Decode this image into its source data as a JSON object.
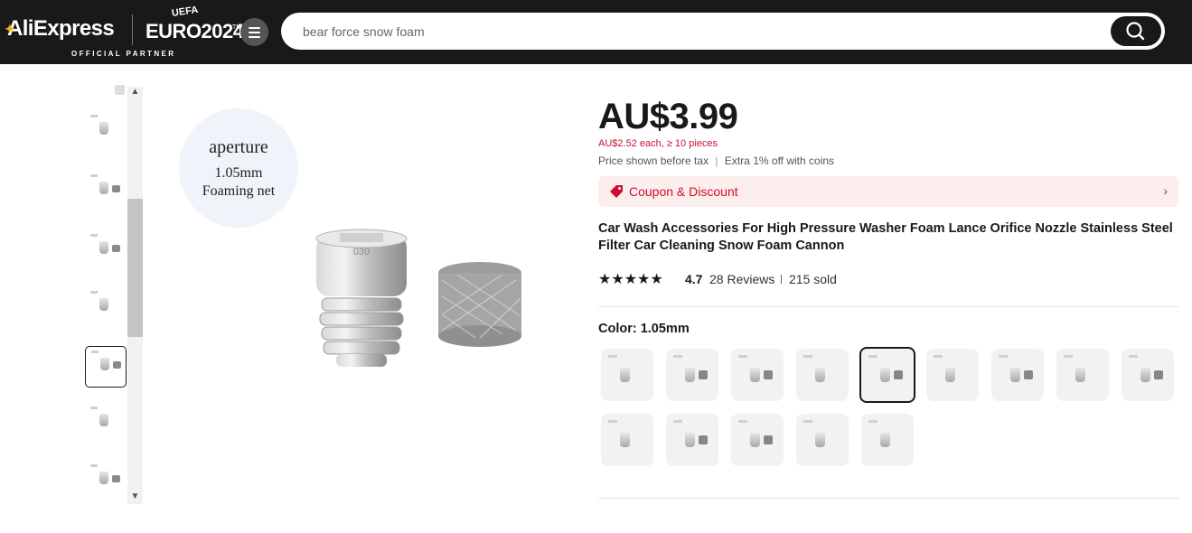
{
  "header": {
    "logo_text": "AliExpress",
    "euro_text": "EURO2024",
    "uefa_text": "UEFA",
    "tm": "TM",
    "partner_text": "OFFICIAL PARTNER",
    "search_value": "bear force snow foam"
  },
  "gallery": {
    "bubble_line1": "aperture",
    "bubble_line2": "1.05mm",
    "bubble_line3": "Foaming net",
    "nozzle_engraving": "030"
  },
  "product": {
    "price": "AU$3.99",
    "bulk_price": "AU$2.52 each, ≥ 10 pieces",
    "tax_note": "Price shown before tax",
    "coins_note": "Extra 1% off with coins",
    "coupon_label": "Coupon & Discount",
    "title": "Car Wash Accessories For High Pressure Washer Foam Lance Orifice Nozzle Stainless Steel Filter Car Cleaning Snow Foam Cannon",
    "rating": "4.7",
    "stars": "★★★★★",
    "reviews": "28 Reviews",
    "sold": "215 sold",
    "color_label": "Color: 1.05mm"
  },
  "icons": {
    "search": "search-icon",
    "menu": "menu-icon",
    "coupon": "coupon-tag-icon",
    "chevron": "chevron-right-icon"
  },
  "colors": {
    "header_bg": "#191919",
    "accent_red": "#c8102e",
    "coupon_bg": "#fdeeee"
  }
}
